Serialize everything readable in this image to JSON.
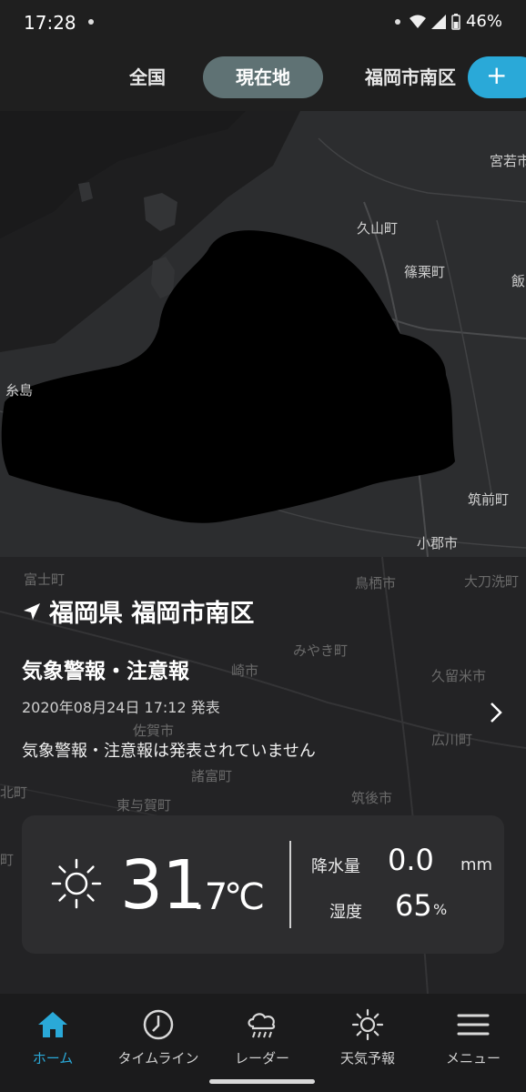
{
  "status_bar": {
    "time": "17:28",
    "battery": "46%"
  },
  "tabs": [
    {
      "label": "全国"
    },
    {
      "label": "現在地"
    },
    {
      "label": "福岡市南区"
    }
  ],
  "add_button": {
    "label": "+"
  },
  "map_labels": {
    "miyawaka": "宮若市",
    "hisayama": "久山町",
    "sasaguri": "篠栗町",
    "ii": "飯",
    "itoshima": "糸島",
    "chikuzen": "筑前町",
    "ogori": "小郡市",
    "fujicho": "富士町",
    "tosu": "鳥栖市",
    "tachiarai": "大刀洗町",
    "miyaki": "みやき町",
    "kurume": "久留米市",
    "saga": "佐賀市",
    "hirokawa": "広川町",
    "morodomi": "諸富町",
    "chikugo": "筑後市",
    "higashiyoka": "東与賀町",
    "kita": "北町",
    "saki": "崎市",
    "kita_left": "北町",
    "machi": "町"
  },
  "location": {
    "name": "福岡県 福岡市南区"
  },
  "warning": {
    "title": "気象警報・注意報",
    "date": "2020年08月24日 17:12 発表",
    "body": "気象警報・注意報は発表されていません"
  },
  "weather": {
    "icon": "sun-icon",
    "temp_int": "31",
    "temp_dec": ".7",
    "temp_unit": "℃",
    "rain_label": "降水量",
    "rain_value": "0.0",
    "rain_unit": "mm",
    "humidity_label": "湿度",
    "humidity_value": "65",
    "humidity_unit": "%"
  },
  "bottom_nav": [
    {
      "label": "ホーム",
      "icon": "home-icon"
    },
    {
      "label": "タイムライン",
      "icon": "clock-icon"
    },
    {
      "label": "レーダー",
      "icon": "rain-cloud-icon"
    },
    {
      "label": "天気予報",
      "icon": "sun-icon"
    },
    {
      "label": "メニュー",
      "icon": "menu-icon"
    }
  ],
  "colors": {
    "accent": "#2aa9d8",
    "active_tab": "#5f7274",
    "card": "#2d2d2f",
    "background": "#1b1b1c"
  }
}
